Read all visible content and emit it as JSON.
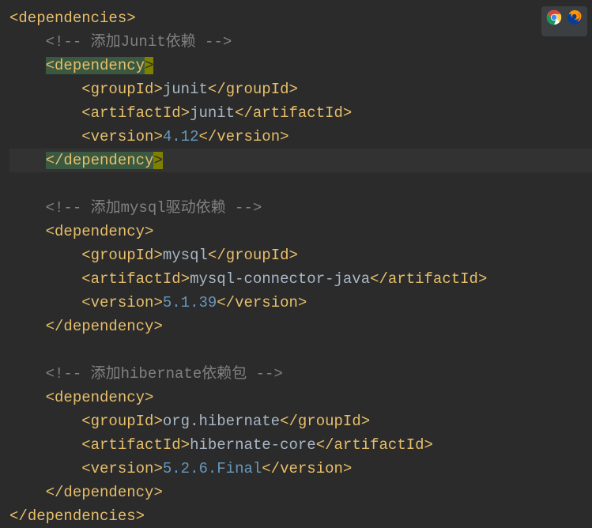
{
  "code": {
    "root_open": "dependencies",
    "root_close": "dependencies",
    "dep1": {
      "comment": "!-- 添加Junit依赖 --",
      "open": "dependency",
      "groupId_tag": "groupId",
      "groupId_val": "junit",
      "artifactId_tag": "artifactId",
      "artifactId_val": "junit",
      "version_tag": "version",
      "version_val": "4.12",
      "close": "dependency"
    },
    "dep2": {
      "comment": "!-- 添加mysql驱动依赖 --",
      "open": "dependency",
      "groupId_tag": "groupId",
      "groupId_val": "mysql",
      "artifactId_tag": "artifactId",
      "artifactId_val": "mysql-connector-java",
      "version_tag": "version",
      "version_val": "5.1.39",
      "close": "dependency"
    },
    "dep3": {
      "comment": "!-- 添加hibernate依赖包 --",
      "open": "dependency",
      "groupId_tag": "groupId",
      "groupId_val": "org.hibernate",
      "artifactId_tag": "artifactId",
      "artifactId_val": "hibernate-core",
      "version_tag": "version",
      "version_val": "5.2.6.Final",
      "close": "dependency"
    }
  },
  "icons": {
    "chrome": "chrome-icon",
    "firefox": "firefox-icon"
  }
}
